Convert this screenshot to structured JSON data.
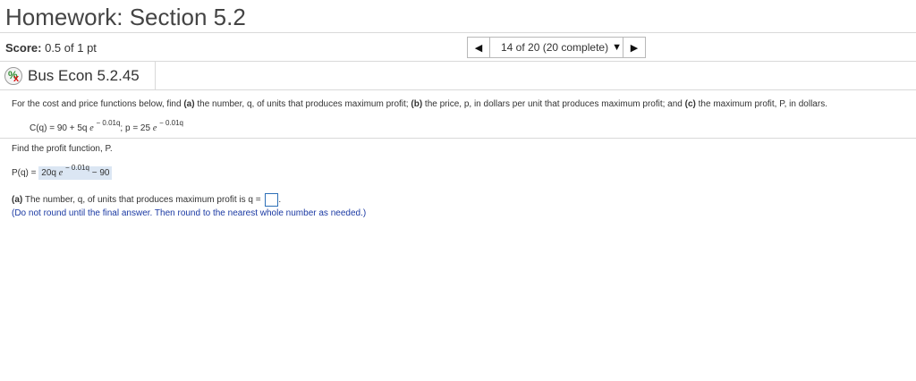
{
  "header": {
    "title": "Homework: Section 5.2"
  },
  "score": {
    "label": "Score:",
    "value": "0.5 of 1 pt"
  },
  "nav": {
    "prev_icon": "triangle-left-icon",
    "position": "14 of 20 (20 complete)",
    "dropdown_icon": "triangle-down-icon",
    "next_icon": "triangle-right-icon"
  },
  "question": {
    "status_icon": "partial-credit-icon",
    "name": "Bus Econ 5.2.45",
    "prompt": {
      "p1": "For the cost and price functions below, find ",
      "a": "(a)",
      "p2": " the number, q, of units that produces maximum profit; ",
      "b": "(b)",
      "p3": " the price, p, in dollars per unit that produces maximum profit; and ",
      "c": "(c)",
      "p4": " the maximum profit, P, in dollars."
    },
    "formula": {
      "c_lhs": "C(q) = 90 + 5q",
      "e": "e",
      "c_exp": "− 0.01q",
      "sep": "; p = 25",
      "p_exp": "− 0.01q"
    },
    "find_text": "Find the profit function, P.",
    "profit": {
      "lhs": "P(q) = ",
      "coef": "20q",
      "e": "e",
      "exp": "− 0.01q",
      "tail": " − 90"
    },
    "part_a": {
      "label": "(a)",
      "text": " The number, q, of units that produces maximum profit is q = ",
      "end": "."
    },
    "hint": "(Do not round until the final answer. Then round to the nearest whole number as needed.)"
  }
}
